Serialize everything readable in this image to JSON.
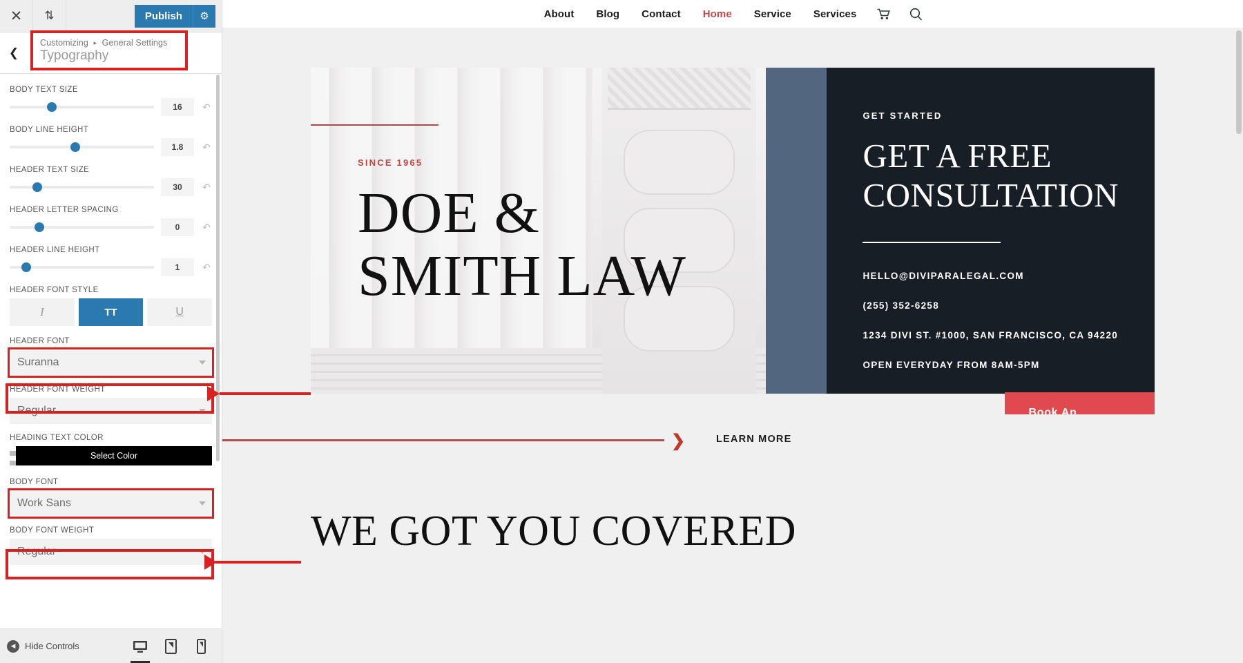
{
  "customizer": {
    "topbar": {
      "close_icon": "close-icon",
      "devices_icon": "sort-updown-icon",
      "publish_label": "Publish",
      "gear_icon": "gear-icon"
    },
    "header": {
      "back_icon": "chevron-left-icon",
      "breadcrumb_root": "Customizing",
      "breadcrumb_sep": "▸",
      "breadcrumb_parent": "General Settings",
      "panel_title": "Typography"
    },
    "controls": [
      {
        "label": "BODY TEXT SIZE",
        "value": "16",
        "knob_pct": 26,
        "reset_icon": "reset-icon"
      },
      {
        "label": "BODY LINE HEIGHT",
        "value": "1.8",
        "knob_pct": 42,
        "reset_icon": "reset-icon"
      },
      {
        "label": "HEADER TEXT SIZE",
        "value": "30",
        "knob_pct": 16,
        "reset_icon": "reset-icon"
      },
      {
        "label": "HEADER LETTER SPACING",
        "value": "0",
        "knob_pct": 17,
        "reset_icon": "reset-icon"
      },
      {
        "label": "HEADER LINE HEIGHT",
        "value": "1",
        "knob_pct": 8,
        "reset_icon": "reset-icon"
      }
    ],
    "header_font_style": {
      "label": "HEADER FONT STYLE",
      "buttons": [
        {
          "glyph": "I",
          "name": "italic-button",
          "active": false
        },
        {
          "glyph": "TT",
          "name": "uppercase-button",
          "active": true
        },
        {
          "glyph": "U",
          "name": "underline-button",
          "active": false
        }
      ]
    },
    "header_font": {
      "label": "HEADER FONT",
      "value": "Suranna",
      "highlighted": true
    },
    "header_font_weight": {
      "label": "HEADER FONT WEIGHT",
      "value": "Regular",
      "highlighted": false
    },
    "heading_text_color": {
      "label": "HEADING TEXT COLOR",
      "button_label": "Select Color",
      "color": "#000000"
    },
    "body_font": {
      "label": "BODY FONT",
      "value": "Work Sans",
      "highlighted": true
    },
    "body_font_weight": {
      "label": "BODY FONT WEIGHT",
      "value": "Regular",
      "highlighted": false
    },
    "footer": {
      "hide_controls_label": "Hide Controls",
      "hide_controls_icon": "collapse-left-icon",
      "devices": [
        {
          "name": "desktop-preview-button",
          "icon": "desktop-icon",
          "active": true
        },
        {
          "name": "tablet-preview-button",
          "icon": "tablet-icon",
          "active": false
        },
        {
          "name": "mobile-preview-button",
          "icon": "mobile-icon",
          "active": false
        }
      ]
    }
  },
  "preview": {
    "nav": {
      "items": [
        {
          "label": "About",
          "current": false
        },
        {
          "label": "Blog",
          "current": false
        },
        {
          "label": "Contact",
          "current": false
        },
        {
          "label": "Home",
          "current": true
        },
        {
          "label": "Service",
          "current": false
        },
        {
          "label": "Services",
          "current": false
        }
      ],
      "cart_icon": "shopping-cart-icon",
      "search_icon": "search-icon"
    },
    "hero": {
      "since": "SINCE 1965",
      "title_line1": "DOE &",
      "title_line2": "SMITH LAW",
      "kicker": "GET STARTED",
      "headline_line1": "GET A FREE",
      "headline_line2": "CONSULTATION",
      "contact": [
        "HELLO@DIVIPARALEGAL.COM",
        "(255) 352-6258",
        "1234 DIVI ST. #1000, SAN FRANCISCO, CA 94220",
        "OPEN EVERYDAY FROM 8AM-5PM"
      ],
      "cta_label": "Book An Appointment",
      "cta_color": "#e04a4f",
      "panel_bg": "#181e26",
      "accent_bar": "#52677f"
    },
    "learn_more": {
      "label": "LEARN MORE",
      "chevron_icon": "chevron-down-icon"
    },
    "section_heading": "WE GOT YOU COVERED"
  },
  "annotations": {
    "accent_color": "#d82222",
    "boxes": [
      "panel-title-box",
      "header-font-box",
      "body-font-box"
    ],
    "arrows": [
      "header-font-arrow",
      "body-font-arrow"
    ]
  }
}
